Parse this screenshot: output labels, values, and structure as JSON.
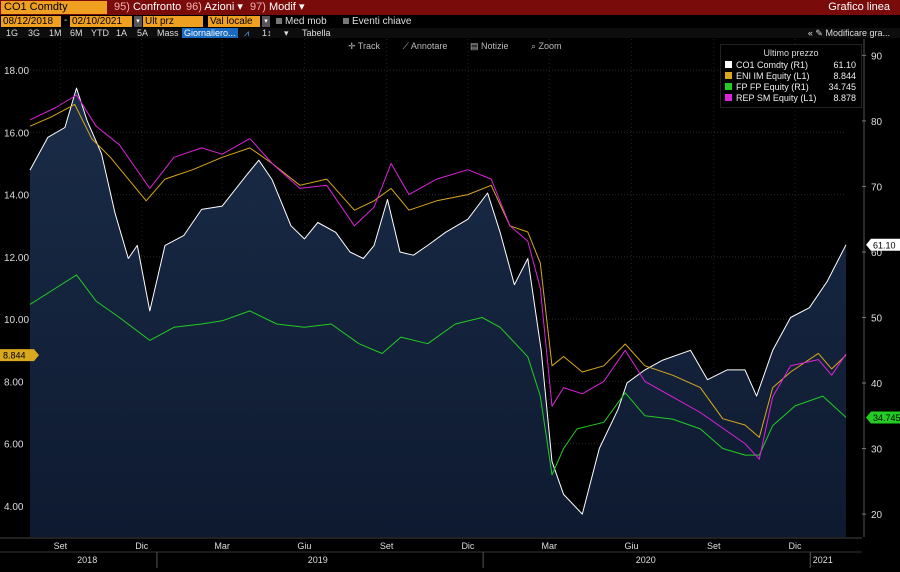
{
  "header": {
    "ticker": "CO1 Comdty",
    "menus": [
      {
        "num": "95)",
        "label": "Confronto"
      },
      {
        "num": "96)",
        "label": "Azioni",
        "arrow": "▾"
      },
      {
        "num": "97)",
        "label": "Modif",
        "arrow": "▾"
      }
    ],
    "title": "Grafico linea"
  },
  "controls": {
    "start_date": "08/12/2018",
    "end_date": "02/10/2021",
    "price_field": "Ult prz",
    "currency_field": "Val locale",
    "moving_avg_label": "Med mob",
    "key_events_label": "Eventi chiave",
    "ranges": [
      "1G",
      "3G",
      "1M",
      "6M",
      "YTD",
      "1A",
      "5A",
      "Mass"
    ],
    "frequency": "Giornaliero...",
    "table_label": "Tabella",
    "edit_chart_label": "Modificare gra..."
  },
  "toolbar": {
    "track": "Track",
    "annotate": "Annotare",
    "news": "Notizie",
    "zoom": "Zoom"
  },
  "legend": {
    "header": "Ultimo prezzo",
    "items": [
      {
        "name": "CO1 Comdty",
        "axis": "(R1)",
        "value": "61.10",
        "color": "#ffffff"
      },
      {
        "name": "ENI IM Equity",
        "axis": "(L1)",
        "value": "8.844",
        "color": "#d9a81e"
      },
      {
        "name": "FP FP Equity",
        "axis": "(R1)",
        "value": "34.745",
        "color": "#22cc22"
      },
      {
        "name": "REP SM Equity",
        "axis": "(L1)",
        "value": "8.878",
        "color": "#dd22dd"
      }
    ]
  },
  "chart_data": {
    "type": "line",
    "left_axis": {
      "ylim": [
        3.0,
        19.0
      ],
      "ticks": [
        "4.00",
        "6.00",
        "8.00",
        "10.00",
        "12.00",
        "14.00",
        "16.00",
        "18.00"
      ]
    },
    "right_axis": {
      "ylim": [
        16.5,
        92.5
      ],
      "ticks": [
        "20",
        "30",
        "40",
        "50",
        "60",
        "70",
        "80",
        "90"
      ]
    },
    "x_labels": [
      {
        "label": "Set",
        "date": "2018-09-15"
      },
      {
        "label": "Dic",
        "date": "2018-12-15"
      },
      {
        "label": "Mar",
        "date": "2019-03-15"
      },
      {
        "label": "Giu",
        "date": "2019-06-15"
      },
      {
        "label": "Set",
        "date": "2019-09-15"
      },
      {
        "label": "Dic",
        "date": "2019-12-15"
      },
      {
        "label": "Mar",
        "date": "2020-03-15"
      },
      {
        "label": "Giu",
        "date": "2020-06-15"
      },
      {
        "label": "Set",
        "date": "2020-09-15"
      },
      {
        "label": "Dic",
        "date": "2020-12-15"
      }
    ],
    "years": [
      {
        "label": "2018",
        "date": "2018-10-15"
      },
      {
        "label": "2019",
        "date": "2019-06-30"
      },
      {
        "label": "2020",
        "date": "2020-07-01"
      },
      {
        "label": "2021",
        "date": "2021-01-15"
      }
    ],
    "series": [
      {
        "name": "CO1 Comdty",
        "axis": "right",
        "color": "#ffffff",
        "area": true,
        "last": "61.10",
        "points": [
          [
            "2018-08-12",
            72.5
          ],
          [
            "2018-09-01",
            77.5
          ],
          [
            "2018-09-20",
            79.0
          ],
          [
            "2018-10-03",
            85.0
          ],
          [
            "2018-10-15",
            80.0
          ],
          [
            "2018-10-31",
            75.0
          ],
          [
            "2018-11-15",
            66.0
          ],
          [
            "2018-11-30",
            59.0
          ],
          [
            "2018-12-10",
            61.0
          ],
          [
            "2018-12-24",
            51.0
          ],
          [
            "2019-01-10",
            61.0
          ],
          [
            "2019-01-31",
            62.5
          ],
          [
            "2019-02-20",
            66.5
          ],
          [
            "2019-03-15",
            67.0
          ],
          [
            "2019-04-10",
            71.5
          ],
          [
            "2019-04-25",
            74.0
          ],
          [
            "2019-05-10",
            71.0
          ],
          [
            "2019-05-31",
            64.0
          ],
          [
            "2019-06-15",
            62.0
          ],
          [
            "2019-06-30",
            64.5
          ],
          [
            "2019-07-20",
            63.0
          ],
          [
            "2019-08-05",
            60.0
          ],
          [
            "2019-08-20",
            59.0
          ],
          [
            "2019-09-01",
            61.0
          ],
          [
            "2019-09-16",
            68.0
          ],
          [
            "2019-09-30",
            60.0
          ],
          [
            "2019-10-15",
            59.5
          ],
          [
            "2019-10-31",
            61.0
          ],
          [
            "2019-11-20",
            63.0
          ],
          [
            "2019-12-15",
            65.0
          ],
          [
            "2020-01-06",
            69.0
          ],
          [
            "2020-01-20",
            63.0
          ],
          [
            "2020-02-05",
            55.0
          ],
          [
            "2020-02-20",
            59.0
          ],
          [
            "2020-03-06",
            45.0
          ],
          [
            "2020-03-18",
            28.0
          ],
          [
            "2020-03-31",
            23.0
          ],
          [
            "2020-04-21",
            20.0
          ],
          [
            "2020-05-10",
            30.0
          ],
          [
            "2020-05-31",
            36.0
          ],
          [
            "2020-06-10",
            40.0
          ],
          [
            "2020-06-30",
            42.0
          ],
          [
            "2020-07-20",
            43.5
          ],
          [
            "2020-08-20",
            45.0
          ],
          [
            "2020-09-08",
            40.5
          ],
          [
            "2020-09-30",
            42.0
          ],
          [
            "2020-10-20",
            42.0
          ],
          [
            "2020-11-02",
            38.0
          ],
          [
            "2020-11-20",
            45.0
          ],
          [
            "2020-12-10",
            50.0
          ],
          [
            "2020-12-31",
            51.5
          ],
          [
            "2021-01-20",
            55.5
          ],
          [
            "2021-02-10",
            61.1
          ]
        ]
      },
      {
        "name": "ENI IM Equity",
        "axis": "left",
        "color": "#d9a81e",
        "last": "8.844",
        "points": [
          [
            "2018-08-12",
            16.2
          ],
          [
            "2018-09-05",
            16.5
          ],
          [
            "2018-10-01",
            16.9
          ],
          [
            "2018-10-20",
            15.8
          ],
          [
            "2018-11-10",
            15.2
          ],
          [
            "2018-11-30",
            14.5
          ],
          [
            "2018-12-20",
            13.8
          ],
          [
            "2019-01-10",
            14.5
          ],
          [
            "2019-02-10",
            14.8
          ],
          [
            "2019-03-15",
            15.2
          ],
          [
            "2019-04-15",
            15.5
          ],
          [
            "2019-05-10",
            15.0
          ],
          [
            "2019-06-10",
            14.3
          ],
          [
            "2019-07-10",
            14.5
          ],
          [
            "2019-08-10",
            13.5
          ],
          [
            "2019-09-01",
            13.8
          ],
          [
            "2019-09-20",
            14.2
          ],
          [
            "2019-10-10",
            13.5
          ],
          [
            "2019-11-10",
            13.8
          ],
          [
            "2019-12-15",
            14.0
          ],
          [
            "2020-01-10",
            14.3
          ],
          [
            "2020-01-31",
            13.0
          ],
          [
            "2020-02-20",
            12.8
          ],
          [
            "2020-03-05",
            11.8
          ],
          [
            "2020-03-18",
            8.5
          ],
          [
            "2020-03-31",
            8.8
          ],
          [
            "2020-04-21",
            8.3
          ],
          [
            "2020-05-15",
            8.5
          ],
          [
            "2020-06-08",
            9.2
          ],
          [
            "2020-06-30",
            8.5
          ],
          [
            "2020-07-31",
            8.2
          ],
          [
            "2020-08-31",
            7.8
          ],
          [
            "2020-09-25",
            6.8
          ],
          [
            "2020-10-20",
            6.6
          ],
          [
            "2020-11-05",
            6.2
          ],
          [
            "2020-11-20",
            7.8
          ],
          [
            "2020-12-10",
            8.3
          ],
          [
            "2021-01-10",
            8.9
          ],
          [
            "2021-01-25",
            8.4
          ],
          [
            "2021-02-10",
            8.844
          ]
        ]
      },
      {
        "name": "FP FP Equity",
        "axis": "right",
        "color": "#22cc22",
        "last": "34.745",
        "points": [
          [
            "2018-08-12",
            52.0
          ],
          [
            "2018-09-10",
            54.5
          ],
          [
            "2018-10-03",
            56.5
          ],
          [
            "2018-10-25",
            52.5
          ],
          [
            "2018-11-20",
            50.0
          ],
          [
            "2018-12-24",
            46.5
          ],
          [
            "2019-01-20",
            48.5
          ],
          [
            "2019-02-20",
            49.0
          ],
          [
            "2019-03-15",
            49.5
          ],
          [
            "2019-04-15",
            51.0
          ],
          [
            "2019-05-15",
            49.0
          ],
          [
            "2019-06-15",
            48.5
          ],
          [
            "2019-07-15",
            49.0
          ],
          [
            "2019-08-15",
            46.0
          ],
          [
            "2019-09-10",
            44.5
          ],
          [
            "2019-10-01",
            47.0
          ],
          [
            "2019-10-31",
            46.0
          ],
          [
            "2019-12-01",
            49.0
          ],
          [
            "2019-12-31",
            50.0
          ],
          [
            "2020-01-20",
            48.5
          ],
          [
            "2020-02-20",
            44.0
          ],
          [
            "2020-03-05",
            38.0
          ],
          [
            "2020-03-18",
            26.0
          ],
          [
            "2020-03-31",
            30.0
          ],
          [
            "2020-04-15",
            33.0
          ],
          [
            "2020-05-15",
            34.0
          ],
          [
            "2020-06-08",
            38.5
          ],
          [
            "2020-06-30",
            35.0
          ],
          [
            "2020-07-31",
            34.5
          ],
          [
            "2020-08-31",
            33.0
          ],
          [
            "2020-09-25",
            30.0
          ],
          [
            "2020-10-20",
            29.0
          ],
          [
            "2020-11-05",
            29.0
          ],
          [
            "2020-11-20",
            33.5
          ],
          [
            "2020-12-15",
            36.5
          ],
          [
            "2021-01-15",
            38.0
          ],
          [
            "2021-02-10",
            34.745
          ]
        ]
      },
      {
        "name": "REP SM Equity",
        "axis": "left",
        "color": "#dd22dd",
        "last": "8.878",
        "points": [
          [
            "2018-08-12",
            16.4
          ],
          [
            "2018-09-10",
            16.8
          ],
          [
            "2018-10-03",
            17.2
          ],
          [
            "2018-10-25",
            16.2
          ],
          [
            "2018-11-20",
            15.6
          ],
          [
            "2018-12-24",
            14.2
          ],
          [
            "2019-01-20",
            15.2
          ],
          [
            "2019-02-20",
            15.5
          ],
          [
            "2019-03-15",
            15.3
          ],
          [
            "2019-04-15",
            15.8
          ],
          [
            "2019-05-10",
            15.0
          ],
          [
            "2019-06-10",
            14.2
          ],
          [
            "2019-07-10",
            14.3
          ],
          [
            "2019-08-10",
            13.0
          ],
          [
            "2019-09-01",
            13.6
          ],
          [
            "2019-09-20",
            15.0
          ],
          [
            "2019-10-10",
            14.0
          ],
          [
            "2019-11-10",
            14.5
          ],
          [
            "2019-12-15",
            14.8
          ],
          [
            "2020-01-10",
            14.5
          ],
          [
            "2020-01-31",
            13.0
          ],
          [
            "2020-02-20",
            12.5
          ],
          [
            "2020-03-05",
            11.0
          ],
          [
            "2020-03-18",
            7.2
          ],
          [
            "2020-03-31",
            7.8
          ],
          [
            "2020-04-21",
            7.6
          ],
          [
            "2020-05-15",
            8.0
          ],
          [
            "2020-06-08",
            9.0
          ],
          [
            "2020-06-30",
            8.0
          ],
          [
            "2020-07-31",
            7.5
          ],
          [
            "2020-08-31",
            7.0
          ],
          [
            "2020-09-25",
            6.5
          ],
          [
            "2020-10-20",
            6.0
          ],
          [
            "2020-11-05",
            5.5
          ],
          [
            "2020-11-20",
            7.5
          ],
          [
            "2020-12-10",
            8.5
          ],
          [
            "2021-01-10",
            8.7
          ],
          [
            "2021-01-25",
            8.2
          ],
          [
            "2021-02-10",
            8.878
          ]
        ]
      }
    ]
  }
}
